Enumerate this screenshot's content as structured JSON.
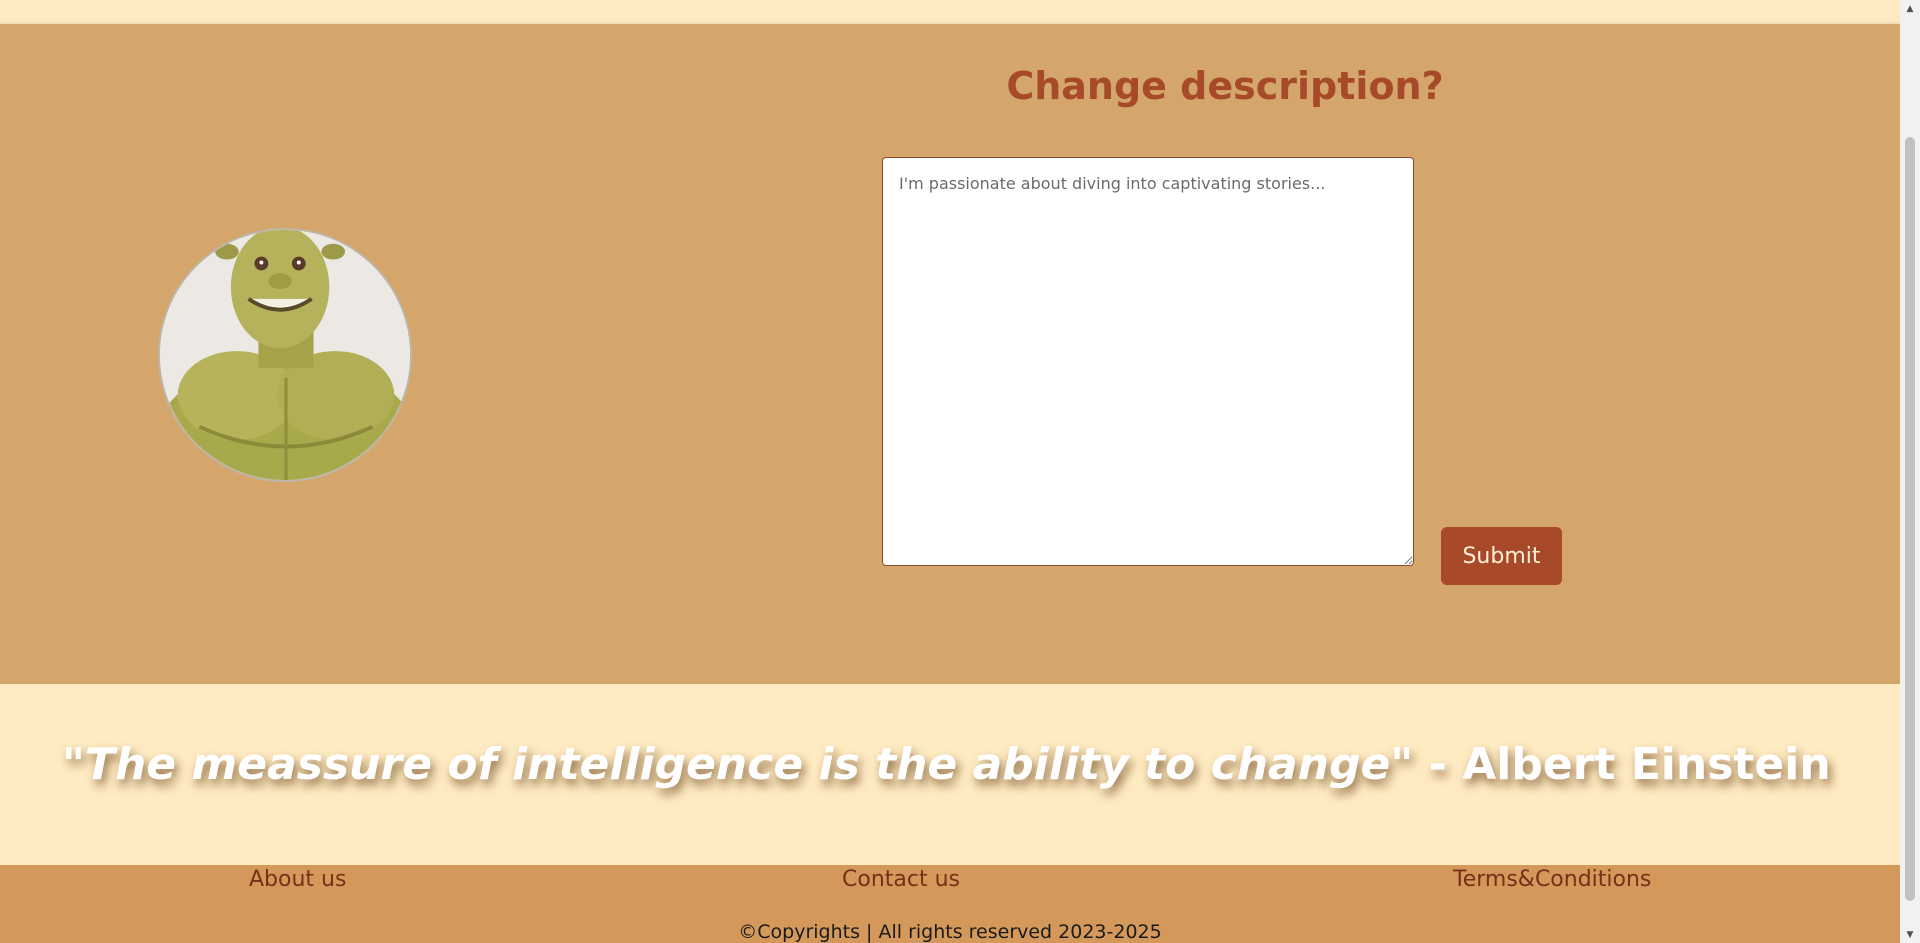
{
  "profile": {
    "description_title": "Change description?",
    "description_placeholder": "I'm passionate about diving into captivating stories...",
    "description_value": "",
    "submit_label": "Submit",
    "avatar_icon": "avatar-photo"
  },
  "quote": {
    "text": "\"The meassure of intelligence is the ability to change\"",
    "author": " - Albert Einstein"
  },
  "footer": {
    "links": [
      {
        "label": "About us"
      },
      {
        "label": "Contact us"
      },
      {
        "label": "Terms&Conditions"
      }
    ],
    "copyright": "©Copyrights | All rights reserved 2023-2025"
  },
  "colors": {
    "card_bg": "#D4A66B",
    "page_bg": "#FFEBC2",
    "accent": "#A8492A",
    "footer_bg": "#D4995A",
    "footer_link": "#7A2E1A"
  },
  "scrollbar": {
    "up_icon": "scroll-up-arrow-icon",
    "down_icon": "scroll-down-arrow-icon"
  }
}
